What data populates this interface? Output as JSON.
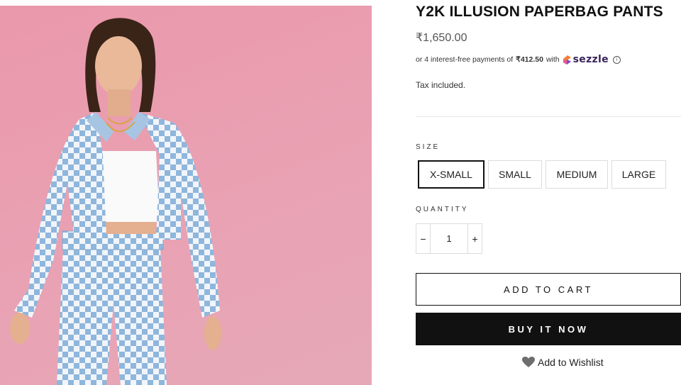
{
  "product": {
    "title": "Y2K ILLUSION PAPERBAG PANTS",
    "price": "₹1,650.00",
    "installments": {
      "prefix": "or 4 interest-free payments of",
      "amount": "₹412.50",
      "with": "with",
      "provider": "sezzle",
      "info_icon": "ⓘ"
    },
    "tax_note": "Tax included."
  },
  "size": {
    "label": "SIZE",
    "options": [
      "X-SMALL",
      "SMALL",
      "MEDIUM",
      "LARGE"
    ],
    "selected": "X-SMALL"
  },
  "quantity": {
    "label": "QUANTITY",
    "value": "1",
    "minus": "−",
    "plus": "+"
  },
  "actions": {
    "add_to_cart": "ADD TO CART",
    "buy_now": "BUY IT NOW",
    "wishlist": "Add to Wishlist"
  },
  "icons": {
    "wishlist": "heart-icon",
    "sezzle": "sezzle-logo-icon"
  },
  "colors": {
    "hero_background": "#ea9fb1",
    "checker_blue": "#8fb6dc",
    "buy_button": "#111111",
    "sezzle_brand": "#392558"
  }
}
